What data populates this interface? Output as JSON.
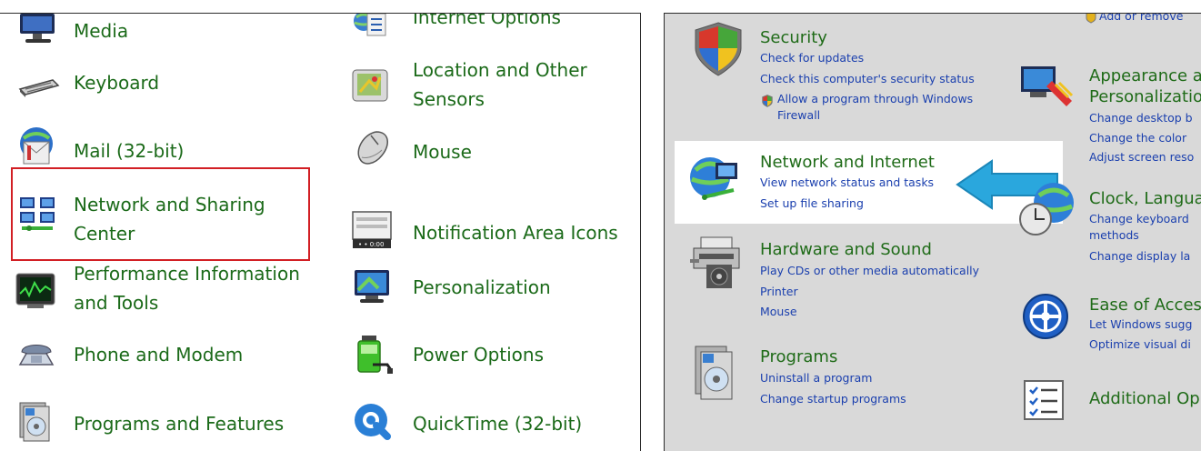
{
  "left_panel": {
    "col1": [
      {
        "label": "Media",
        "icon": "monitor-icon"
      },
      {
        "label": "Keyboard",
        "icon": "keyboard-icon"
      },
      {
        "label": "Mail (32-bit)",
        "icon": "mail-icon"
      },
      {
        "label_line1": "Network and Sharing",
        "label_line2": "Center",
        "icon": "network-sharing-icon"
      },
      {
        "label_line1": "Performance Information",
        "label_line2": "and Tools",
        "icon": "performance-icon"
      },
      {
        "label": "Phone and Modem",
        "icon": "phone-icon"
      },
      {
        "label": "Programs and Features",
        "icon": "programs-features-icon"
      }
    ],
    "col2": [
      {
        "label": "Internet Options",
        "icon": "internet-options-icon"
      },
      {
        "label_line1": "Location and Other",
        "label_line2": "Sensors",
        "icon": "location-sensors-icon"
      },
      {
        "label": "Mouse",
        "icon": "mouse-icon"
      },
      {
        "label": "Notification Area Icons",
        "icon": "notification-area-icon"
      },
      {
        "label": "Personalization",
        "icon": "personalization-icon"
      },
      {
        "label": "Power Options",
        "icon": "power-icon"
      },
      {
        "label": "QuickTime (32-bit)",
        "icon": "quicktime-icon"
      }
    ]
  },
  "right_panel": {
    "top_partial": "Add or remove",
    "security": {
      "title": "Security",
      "links": [
        "Check for updates",
        "Check this computer's security status"
      ],
      "shield_link_line1": "Allow a program through Windows",
      "shield_link_line2": "Firewall"
    },
    "network": {
      "title": "Network and Internet",
      "links": [
        "View network status and tasks",
        "Set up file sharing"
      ]
    },
    "hardware": {
      "title": "Hardware and Sound",
      "links": [
        "Play CDs or other media automatically",
        "Printer",
        "Mouse"
      ]
    },
    "programs": {
      "title": "Programs",
      "links": [
        "Uninstall a program",
        "Change startup programs"
      ]
    },
    "appearance": {
      "title_line1": "Appearance a",
      "title_line2": "Personalizatio",
      "links": [
        "Change desktop b",
        "Change the color",
        "Adjust screen reso"
      ]
    },
    "clock": {
      "title": "Clock, Langua",
      "links": [
        "Change keyboard",
        "methods",
        "Change display la"
      ]
    },
    "ease": {
      "title": "Ease of Access",
      "links": [
        "Let Windows sugg",
        "Optimize visual di"
      ]
    },
    "additional": {
      "title": "Additional Op"
    }
  },
  "colors": {
    "green_text": "#1b6a19",
    "link_blue": "#1a3fae",
    "highlight_red": "#d21f24",
    "arrow_blue": "#2aa7dd",
    "right_bg": "#d9d9d9"
  }
}
